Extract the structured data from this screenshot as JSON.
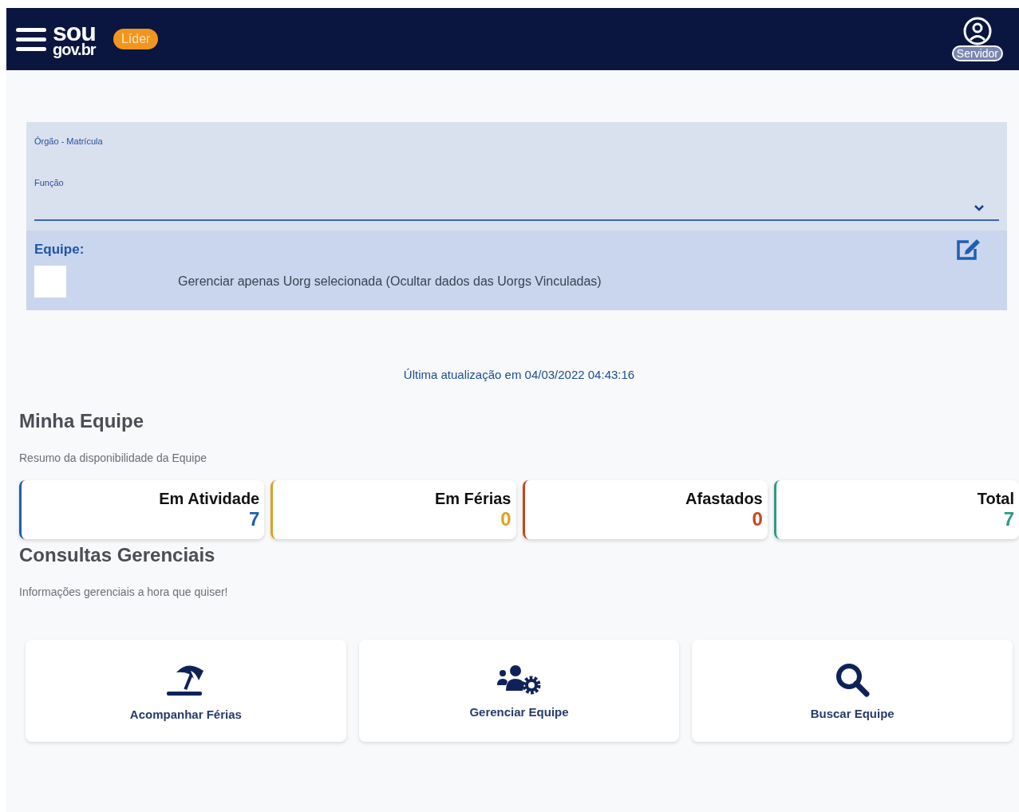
{
  "header": {
    "logo_top": "sou",
    "logo_bottom": "gov.br",
    "role_badge": "Líder",
    "user_label": "Servidor"
  },
  "filter": {
    "org_label": "Órgão - Matrícula",
    "function_label": "Função",
    "team_label": "Equipe:",
    "only_selected": {
      "label": "Gerenciar apenas Uorg selecionada (Ocultar dados das Uorgs Vinculadas)",
      "checked": false
    }
  },
  "last_update": "Última atualização em 04/03/2022 04:43:16",
  "team_section": {
    "title": "Minha Equipe",
    "subtitle": "Resumo da disponibilidade da Equipe"
  },
  "stats": [
    {
      "label": "Em Atividade",
      "value": "7",
      "color": "#1f5fb0"
    },
    {
      "label": "Em Férias",
      "value": "0",
      "color": "#e0a020"
    },
    {
      "label": "Afastados",
      "value": "0",
      "color": "#c8461c"
    },
    {
      "label": "Total",
      "value": "7",
      "color": "#2f9a86"
    }
  ],
  "queries_section": {
    "title": "Consultas Gerenciais",
    "subtitle": "Informações gerenciais a hora que quiser!"
  },
  "actions": [
    {
      "kind": "vacation",
      "label": "Acompanhar Férias"
    },
    {
      "kind": "team",
      "label": "Gerenciar Equipe"
    },
    {
      "kind": "search",
      "label": "Buscar Equipe"
    }
  ]
}
